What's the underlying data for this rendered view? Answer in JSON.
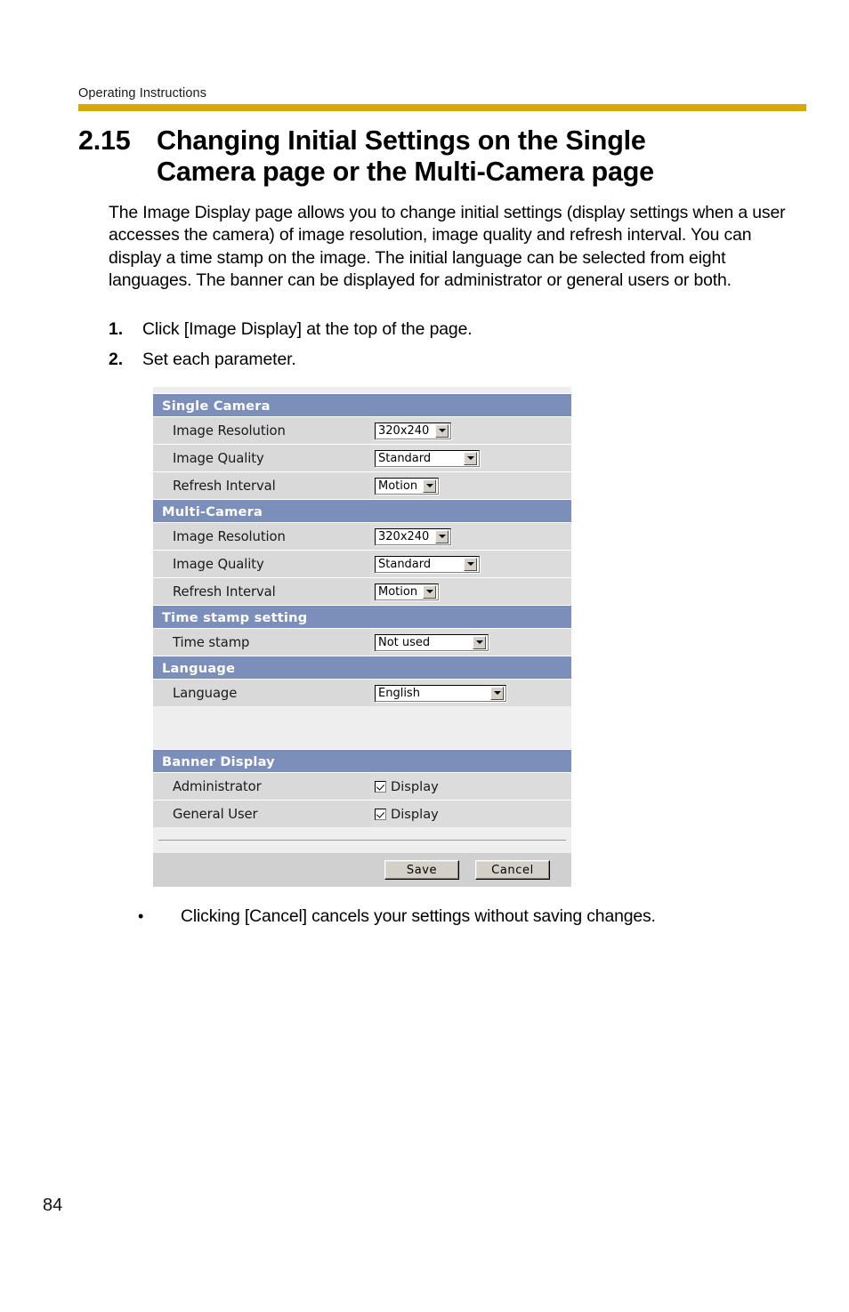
{
  "header": {
    "running_head": "Operating Instructions",
    "rule_color": "#d4a90a"
  },
  "section": {
    "number": "2.15",
    "title_line1": "Changing Initial Settings on the Single",
    "title_line2": "Camera page or the Multi-Camera page"
  },
  "intro": {
    "paragraph": "The Image Display page allows you to change initial settings (display settings when a user accesses the camera) of image resolution, image quality and refresh interval. You can display a time stamp on the image. The initial language can be selected from eight languages. The banner can be displayed for administrator or general users or both."
  },
  "steps": [
    {
      "number": "1.",
      "text": "Click [Image Display] at the top of the page."
    },
    {
      "number": "2.",
      "text": "Set each parameter."
    }
  ],
  "screenshot": {
    "accent_header_color": "#7b8fba",
    "groups": [
      {
        "title": "Single Camera",
        "rows": [
          {
            "label": "Image Resolution",
            "control": "select",
            "value": "320x240"
          },
          {
            "label": "Image Quality",
            "control": "select",
            "value": "Standard"
          },
          {
            "label": "Refresh Interval",
            "control": "select",
            "value": "Motion"
          }
        ]
      },
      {
        "title": "Multi-Camera",
        "rows": [
          {
            "label": "Image Resolution",
            "control": "select",
            "value": "320x240"
          },
          {
            "label": "Image Quality",
            "control": "select",
            "value": "Standard"
          },
          {
            "label": "Refresh Interval",
            "control": "select",
            "value": "Motion"
          }
        ]
      },
      {
        "title": "Time stamp setting",
        "rows": [
          {
            "label": "Time stamp",
            "control": "select",
            "value": "Not used"
          }
        ]
      },
      {
        "title": "Language",
        "rows": [
          {
            "label": "Language",
            "control": "select",
            "value": "English"
          }
        ]
      },
      {
        "title": "Banner Display",
        "rows": [
          {
            "label": "Administrator",
            "control": "checkbox",
            "value": "Display",
            "checked": true
          },
          {
            "label": "General User",
            "control": "checkbox",
            "value": "Display",
            "checked": true
          }
        ]
      }
    ],
    "buttons": {
      "save": "Save",
      "cancel": "Cancel"
    }
  },
  "note": {
    "bullet": "•",
    "text": "Clicking [Cancel] cancels your settings without saving changes."
  },
  "footer": {
    "page_number": "84"
  }
}
